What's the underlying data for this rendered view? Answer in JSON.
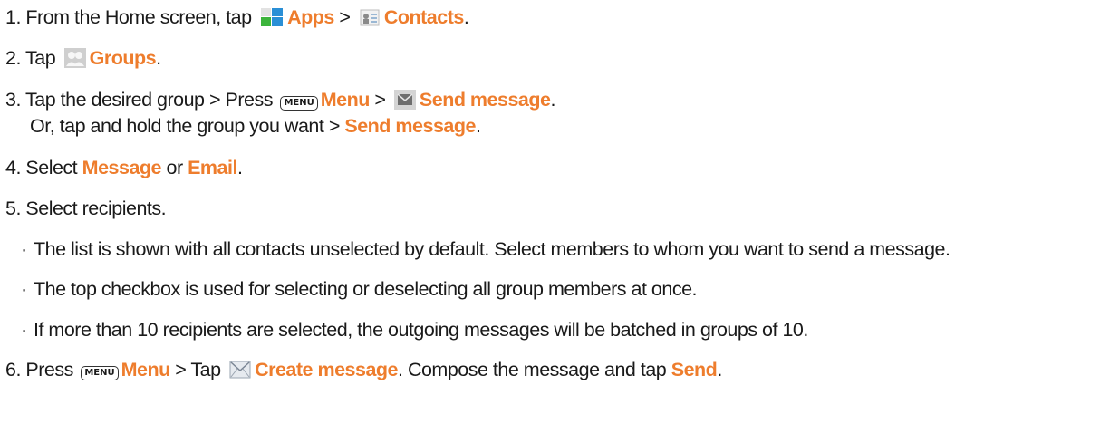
{
  "steps": {
    "s1": {
      "prefix": "1. From the Home screen, tap",
      "apps": "Apps",
      "gt": ">",
      "contacts": "Contacts",
      "end": "."
    },
    "s2": {
      "prefix": "2. Tap",
      "groups": "Groups",
      "end": "."
    },
    "s3": {
      "prefix": "3. Tap the desired group > Press",
      "menu_key": "MENU",
      "menu": "Menu",
      "gt": ">",
      "send": "Send message",
      "end": "."
    },
    "s3b": {
      "prefix": "Or, tap and hold the group you want >",
      "send": "Send message",
      "end": "."
    },
    "s4": {
      "prefix": "4. Select",
      "message": "Message",
      "or": "or",
      "email": "Email",
      "end": "."
    },
    "s5": {
      "text": "5. Select recipients."
    },
    "bullets": [
      "The list is shown with all contacts unselected by default. Select members to whom you want to send a message.",
      "The top checkbox is used for selecting or deselecting all group members at once.",
      "If more than 10 recipients are selected, the outgoing messages will be batched in groups of 10."
    ],
    "bullet_char": "·",
    "s6": {
      "prefix": "6. Press",
      "menu_key": "MENU",
      "menu": "Menu",
      "tap": "> Tap",
      "create": "Create message",
      "mid": ". Compose the message and tap",
      "send": "Send",
      "end": "."
    }
  },
  "colors": {
    "highlight": "#ee7d2d",
    "text": "#1a1a1a"
  },
  "icons": [
    "apps-grid-icon",
    "contacts-icon",
    "groups-icon",
    "send-message-icon",
    "envelope-icon",
    "menu-key-icon"
  ]
}
